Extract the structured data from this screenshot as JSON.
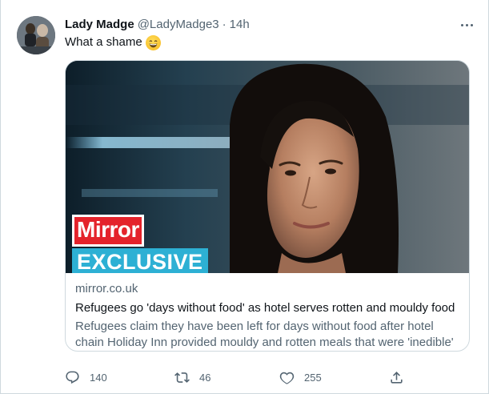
{
  "tweet": {
    "display_name": "Lady Madge",
    "handle": "@LadyMadge3",
    "separator": "·",
    "time": "14h",
    "text": "What a shame",
    "emoji": "grinning-face-with-smiling-eyes"
  },
  "card": {
    "image_labels": {
      "brand": "Mirror",
      "tag": "EXCLUSIVE"
    },
    "domain": "mirror.co.uk",
    "title": "Refugees go 'days without food' as hotel serves rotten and mouldy food",
    "description": "Refugees claim they have been left for days without food after hotel chain Holiday Inn provided mouldy and rotten meals that were 'inedible'"
  },
  "actions": {
    "reply_count": "140",
    "retweet_count": "46",
    "like_count": "255"
  },
  "colors": {
    "text_primary": "#0f1419",
    "text_secondary": "#536471",
    "border": "#cfd9de",
    "mirror_red": "#e4232b",
    "exclusive_blue": "#2db0d4"
  }
}
